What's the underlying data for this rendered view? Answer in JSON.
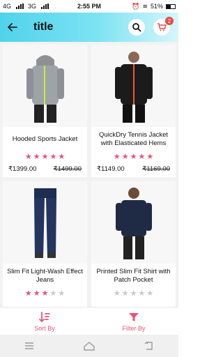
{
  "status_bar": {
    "left_signal_1": "4G",
    "left_signal_2": "3G",
    "time": "2:55 PM",
    "battery": "51%"
  },
  "app_bar": {
    "title": "title",
    "cart_count": "2"
  },
  "products": [
    {
      "name": "Hooded Sports Jacket",
      "price": "₹1399.00",
      "old_price": "₹1499.00",
      "rating": 4.5
    },
    {
      "name": "QuickDry Tennis Jacket with Elasticated Hems",
      "price": "₹1149.00",
      "old_price": "₹1169.00",
      "rating": 4.5
    },
    {
      "name": "Slim Fit Light-Wash Effect Jeans",
      "price": "",
      "old_price": "",
      "rating": 3
    },
    {
      "name": "Printed Slim Fit Shirt with Patch Pocket",
      "price": "",
      "old_price": "",
      "rating": 0
    }
  ],
  "bottom_bar": {
    "sort_label": "Sort By",
    "filter_label": "Filter By"
  },
  "colors": {
    "accent_pink": "#e8527a",
    "appbar_cyan": "#4fd3ea"
  },
  "icons": [
    "back-arrow-icon",
    "search-icon",
    "cart-icon",
    "sort-icon",
    "filter-icon",
    "menu-icon",
    "home-icon",
    "back-nav-icon"
  ]
}
